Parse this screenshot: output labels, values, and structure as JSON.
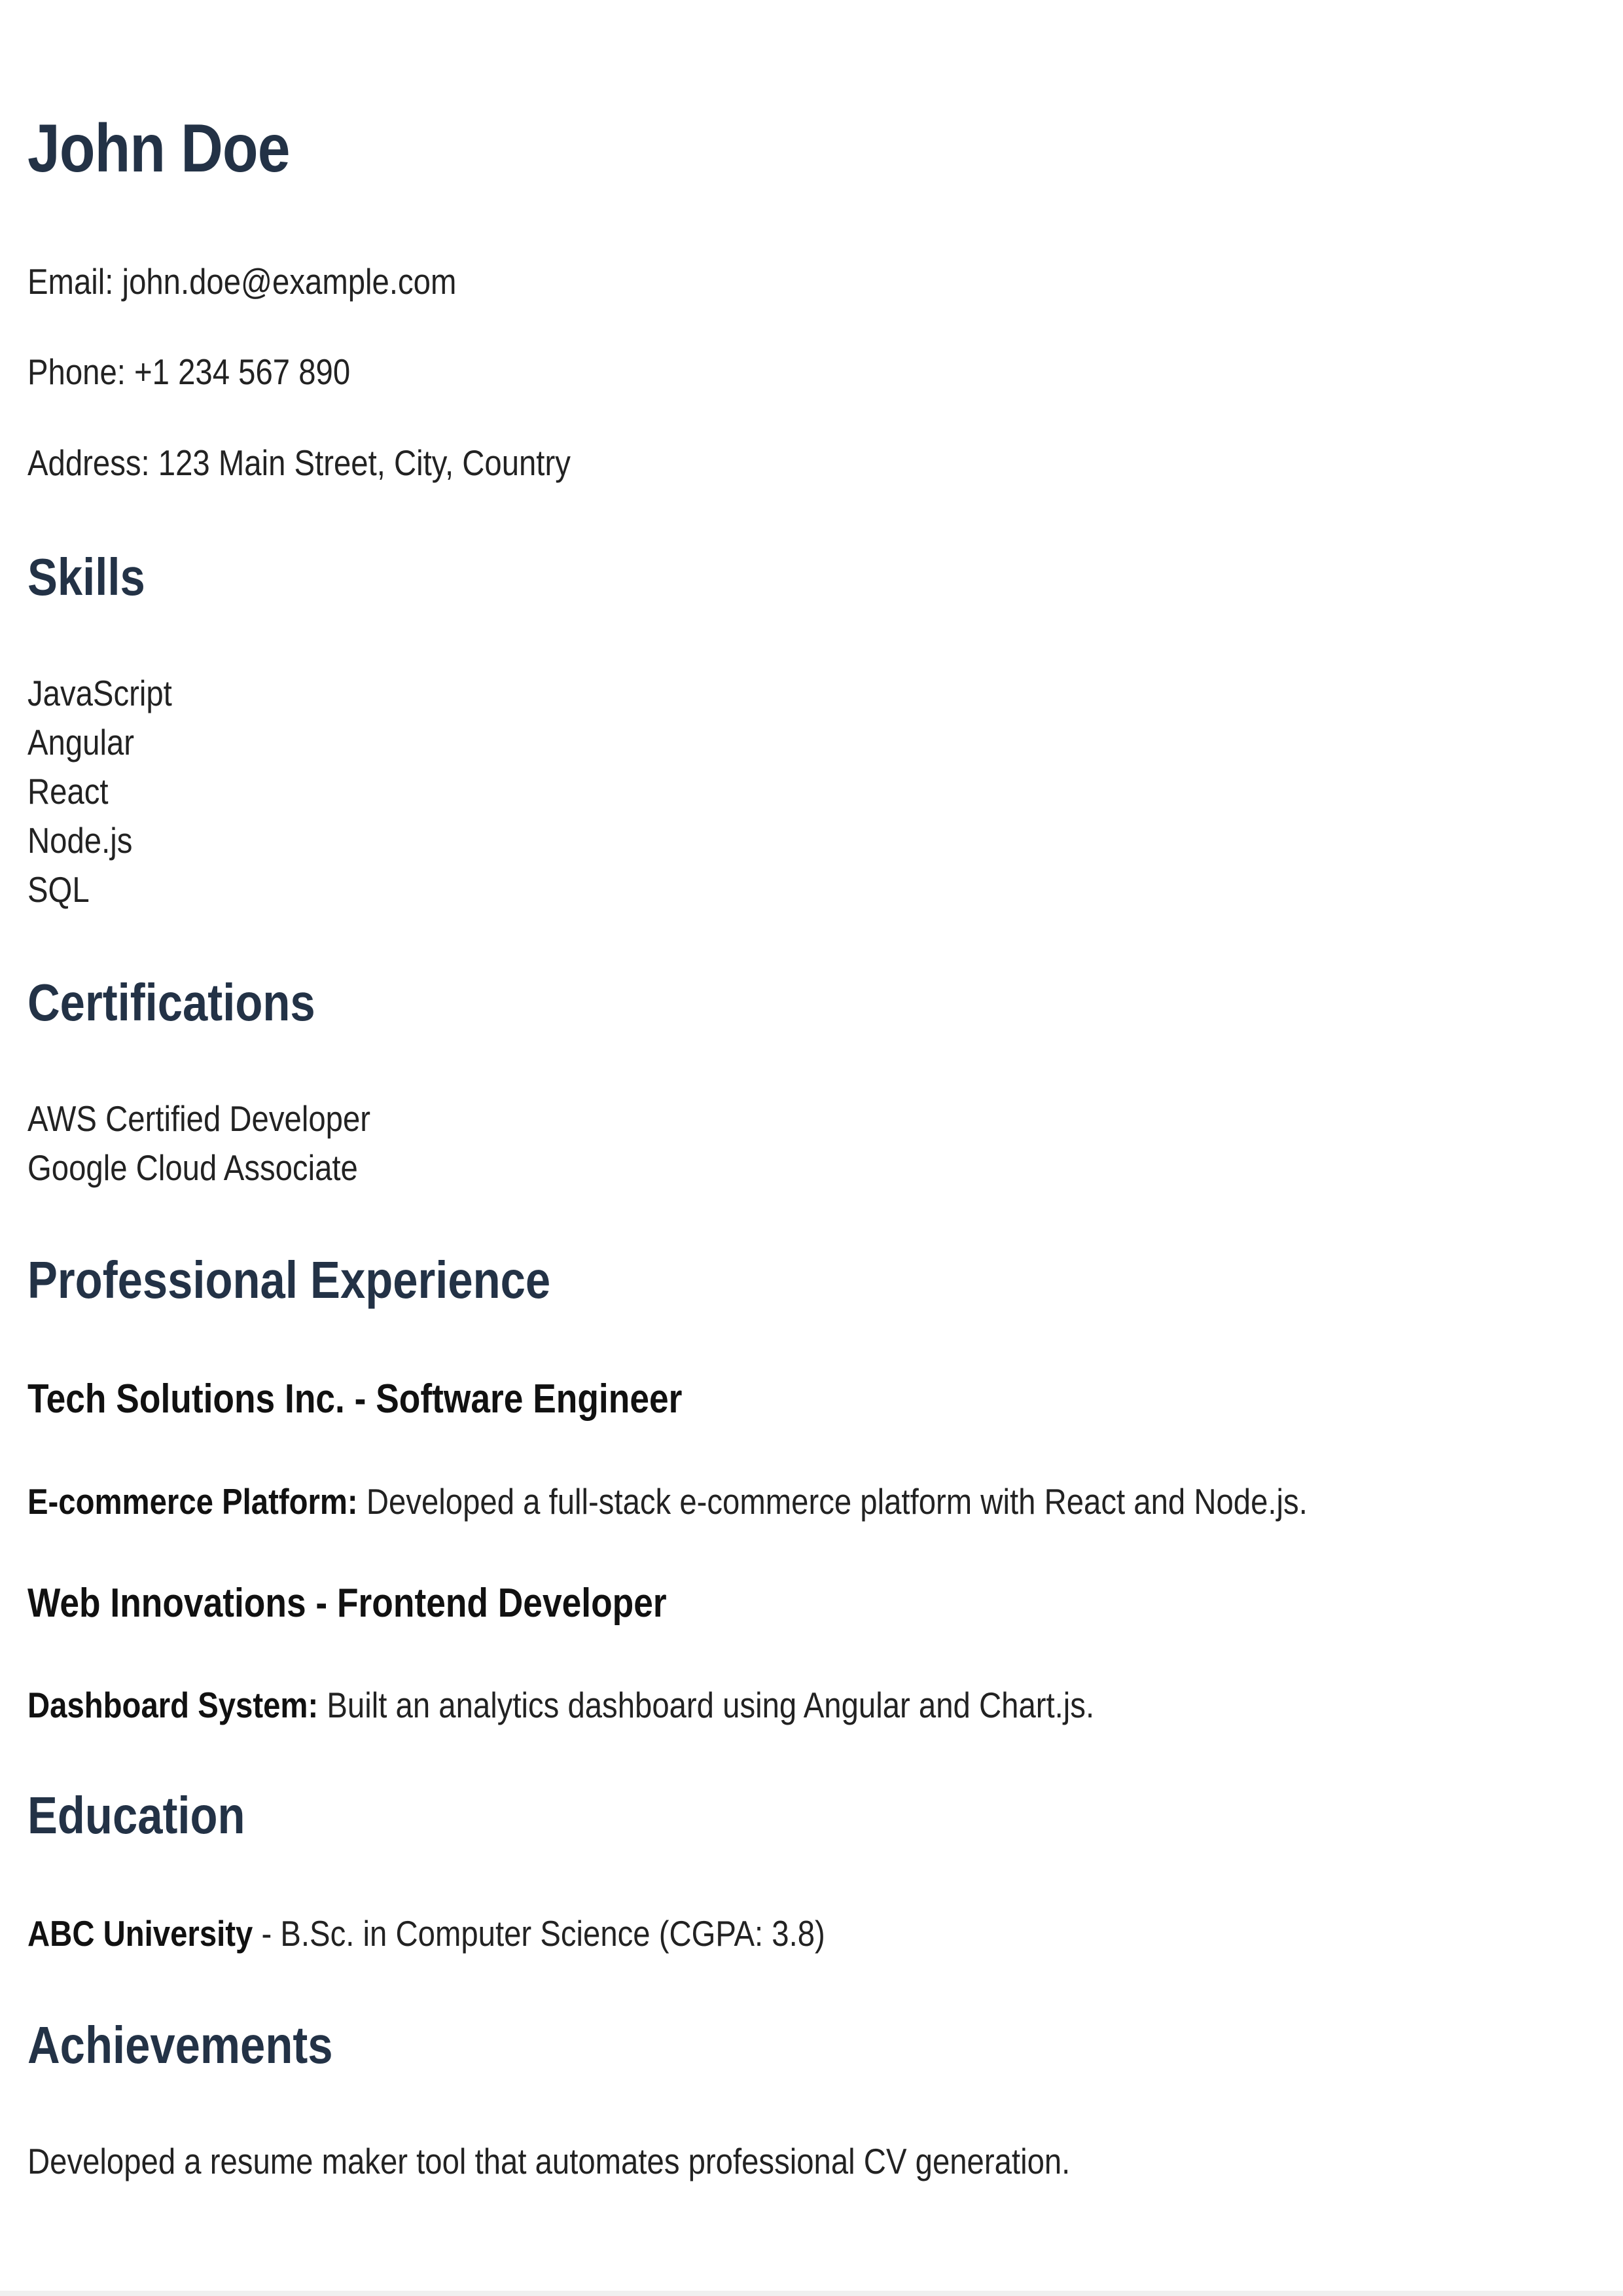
{
  "header": {
    "name": "John Doe",
    "email": "Email: john.doe@example.com",
    "phone": "Phone: +1 234 567 890",
    "address": "Address: 123 Main Street, City, Country"
  },
  "skills": {
    "title": "Skills",
    "items": [
      "JavaScript",
      "Angular",
      "React",
      "Node.js",
      "SQL"
    ]
  },
  "certifications": {
    "title": "Certifications",
    "items": [
      "AWS Certified Developer",
      "Google Cloud Associate"
    ]
  },
  "experience": {
    "title": "Professional Experience",
    "jobs": [
      {
        "heading": "Tech Solutions Inc. - Software Engineer",
        "project_label": "E-commerce Platform:",
        "project_text": " Developed a full-stack e-commerce platform with React and Node.js."
      },
      {
        "heading": "Web Innovations - Frontend Developer",
        "project_label": "Dashboard System:",
        "project_text": " Built an analytics dashboard using Angular and Chart.js."
      }
    ]
  },
  "education": {
    "title": "Education",
    "school": "ABC University",
    "degree": " - B.Sc. in Computer Science (CGPA: 3.8)"
  },
  "achievements": {
    "title": "Achievements",
    "text": "Developed a resume maker tool that automates professional CV generation."
  }
}
